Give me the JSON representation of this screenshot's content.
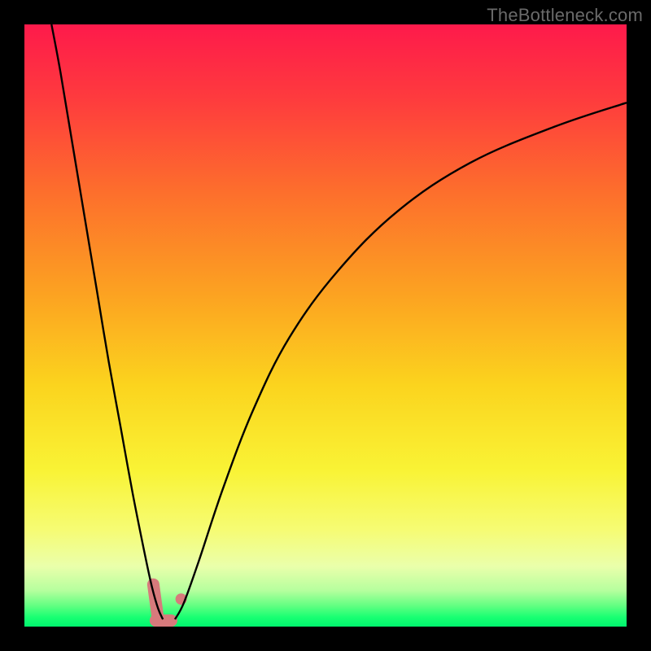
{
  "watermark": "TheBottleneck.com",
  "colors": {
    "frame": "#000000",
    "watermark": "#6a6a6a",
    "curve": "#000000",
    "marker": "#d77a7c",
    "gradient_stops": [
      {
        "offset": 0.0,
        "color": "#fe1a4b"
      },
      {
        "offset": 0.12,
        "color": "#fe3a3e"
      },
      {
        "offset": 0.28,
        "color": "#fd6f2c"
      },
      {
        "offset": 0.45,
        "color": "#fca321"
      },
      {
        "offset": 0.6,
        "color": "#fbd41e"
      },
      {
        "offset": 0.74,
        "color": "#f9f335"
      },
      {
        "offset": 0.84,
        "color": "#f6fc74"
      },
      {
        "offset": 0.9,
        "color": "#eaffab"
      },
      {
        "offset": 0.94,
        "color": "#b6ff9e"
      },
      {
        "offset": 0.965,
        "color": "#63ff82"
      },
      {
        "offset": 0.985,
        "color": "#17ff72"
      },
      {
        "offset": 1.0,
        "color": "#00f56e"
      }
    ]
  },
  "chart_data": {
    "type": "line",
    "title": "",
    "xlabel": "",
    "ylabel": "",
    "xlim": [
      0,
      100
    ],
    "ylim": [
      0,
      100
    ],
    "grid": false,
    "legend": false,
    "note": "Values below are estimated points read off the plotted curves; the original axes carry no tick labels so the coordinate system is treated as 0–100 in each direction.",
    "series": [
      {
        "name": "left-branch",
        "x": [
          4.5,
          6,
          8,
          10,
          12,
          14,
          16,
          18,
          20,
          21.2,
          22.2,
          23.0
        ],
        "y": [
          100,
          92,
          80,
          68,
          56,
          44,
          33,
          22,
          12,
          6.5,
          3.0,
          1.2
        ]
      },
      {
        "name": "right-branch",
        "x": [
          25.0,
          26.5,
          29,
          33,
          38,
          44,
          52,
          62,
          74,
          88,
          100
        ],
        "y": [
          1.2,
          4.0,
          11,
          23,
          36,
          48,
          59,
          69,
          77,
          83,
          87
        ]
      }
    ],
    "markers": [
      {
        "name": "min-region-L-shape",
        "approx_center": {
          "x": 23.5,
          "y": 2.5
        },
        "approx_extent_x": [
          21.4,
          26.3
        ],
        "approx_extent_y": [
          1.0,
          7.0
        ]
      }
    ]
  }
}
